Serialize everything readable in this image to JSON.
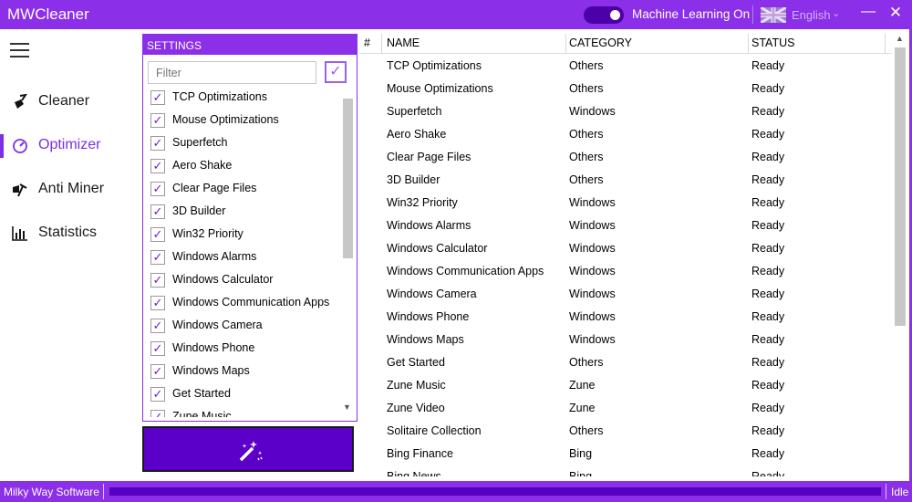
{
  "app": {
    "title": "MWCleaner"
  },
  "titlebar": {
    "ml_label": "Machine Learning On",
    "language": "English",
    "minimize": "—",
    "close": "✕"
  },
  "nav": {
    "items": [
      {
        "label": "Cleaner",
        "icon": "broom-icon"
      },
      {
        "label": "Optimizer",
        "icon": "gauge-icon",
        "active": true
      },
      {
        "label": "Anti Miner",
        "icon": "pickaxe-icon"
      },
      {
        "label": "Statistics",
        "icon": "bar-chart-icon"
      }
    ]
  },
  "settings": {
    "header": "SETTINGS",
    "filter_placeholder": "Filter",
    "items": [
      "TCP Optimizations",
      "Mouse Optimizations",
      "Superfetch",
      "Aero Shake",
      "Clear Page Files",
      "3D Builder",
      "Win32 Priority",
      "Windows Alarms",
      "Windows Calculator",
      "Windows Communication Apps",
      "Windows Camera",
      "Windows Phone",
      "Windows Maps",
      "Get Started",
      "Zune Music"
    ]
  },
  "table": {
    "headers": [
      "#",
      "NAME",
      "CATEGORY",
      "STATUS"
    ],
    "rows": [
      [
        "TCP Optimizations",
        "Others",
        "Ready"
      ],
      [
        "Mouse Optimizations",
        "Others",
        "Ready"
      ],
      [
        "Superfetch",
        "Windows",
        "Ready"
      ],
      [
        "Aero Shake",
        "Others",
        "Ready"
      ],
      [
        "Clear Page Files",
        "Others",
        "Ready"
      ],
      [
        "3D Builder",
        "Others",
        "Ready"
      ],
      [
        "Win32 Priority",
        "Windows",
        "Ready"
      ],
      [
        "Windows Alarms",
        "Windows",
        "Ready"
      ],
      [
        "Windows Calculator",
        "Windows",
        "Ready"
      ],
      [
        "Windows Communication Apps",
        "Windows",
        "Ready"
      ],
      [
        "Windows Camera",
        "Windows",
        "Ready"
      ],
      [
        "Windows Phone",
        "Windows",
        "Ready"
      ],
      [
        "Windows Maps",
        "Windows",
        "Ready"
      ],
      [
        "Get Started",
        "Others",
        "Ready"
      ],
      [
        "Zune Music",
        "Zune",
        "Ready"
      ],
      [
        "Zune Video",
        "Zune",
        "Ready"
      ],
      [
        "Solitaire Collection",
        "Others",
        "Ready"
      ],
      [
        "Bing Finance",
        "Bing",
        "Ready"
      ],
      [
        "Bing News",
        "Bing",
        "Ready"
      ]
    ]
  },
  "status": {
    "company": "Milky Way Software",
    "state": "Idle",
    "progress": 0
  },
  "colors": {
    "accent": "#8b2fe8",
    "button": "#5a00c8"
  }
}
